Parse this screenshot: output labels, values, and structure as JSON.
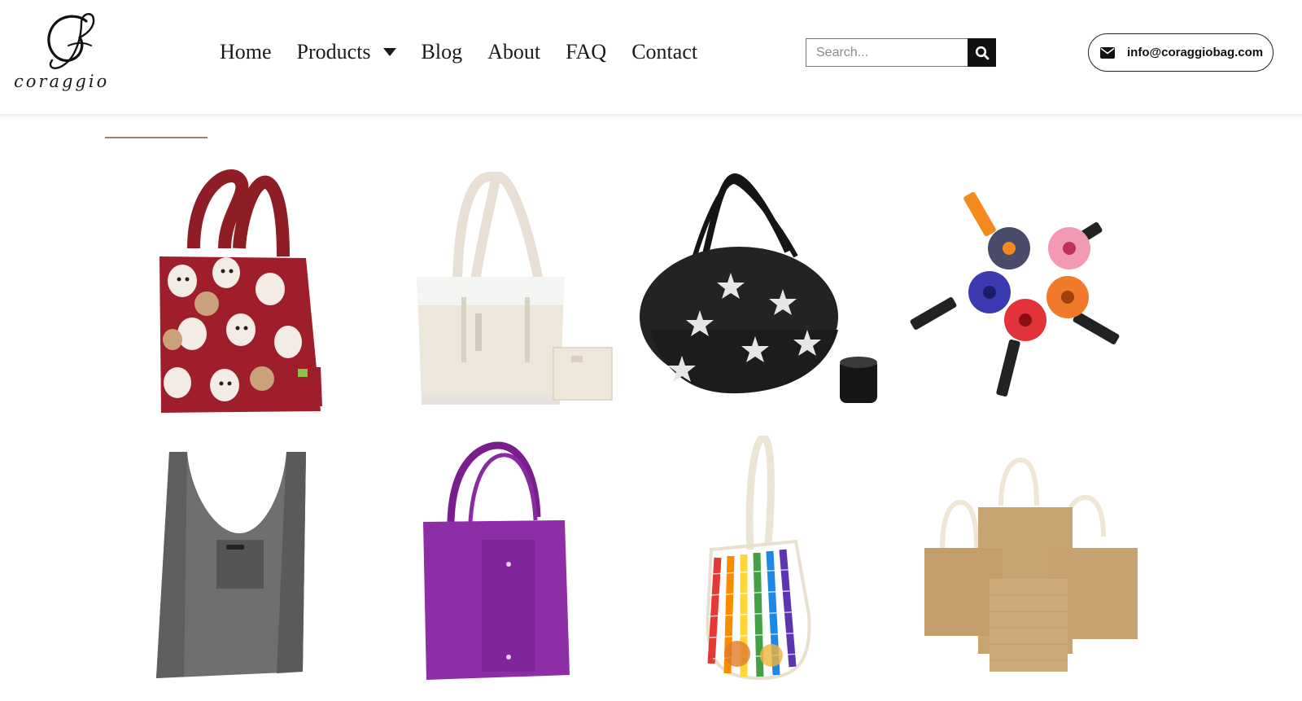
{
  "brand": {
    "wordmark": "coraggio",
    "monogram": "G"
  },
  "nav": {
    "items": [
      {
        "label": "Home"
      },
      {
        "label": "Products"
      },
      {
        "label": "Blog"
      },
      {
        "label": "About"
      },
      {
        "label": "FAQ"
      },
      {
        "label": "Contact"
      }
    ]
  },
  "search": {
    "placeholder": "Search...",
    "value": ""
  },
  "contact": {
    "email": "info@coraggiobag.com"
  },
  "colors": {
    "accent_line": "#a08360",
    "text": "#1a1a1a"
  },
  "products": [
    {
      "name": "red-dog-print-foldable-tote"
    },
    {
      "name": "cream-canvas-tote"
    },
    {
      "name": "black-star-foldable-bag"
    },
    {
      "name": "round-pouch-foldable-bags"
    },
    {
      "name": "grey-foldable-shopping-bag"
    },
    {
      "name": "purple-non-woven-tote"
    },
    {
      "name": "rainbow-mesh-string-bag"
    },
    {
      "name": "jute-burlap-tote-set"
    }
  ]
}
